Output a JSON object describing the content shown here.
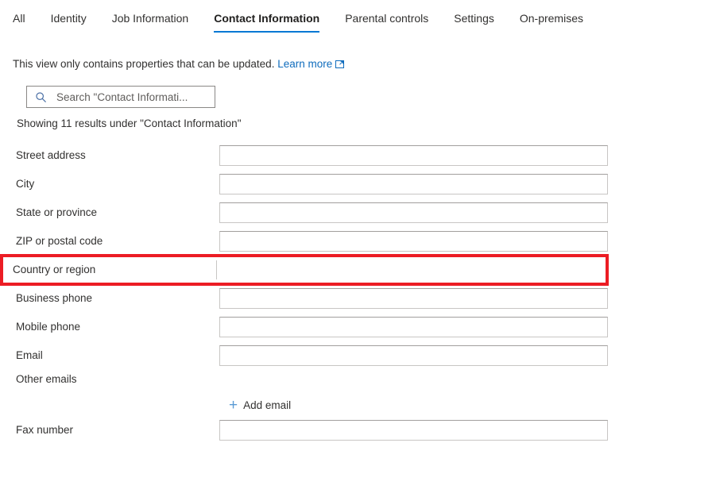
{
  "tabs": [
    {
      "label": "All",
      "active": false
    },
    {
      "label": "Identity",
      "active": false
    },
    {
      "label": "Job Information",
      "active": false
    },
    {
      "label": "Contact Information",
      "active": true
    },
    {
      "label": "Parental controls",
      "active": false
    },
    {
      "label": "Settings",
      "active": false
    },
    {
      "label": "On-premises",
      "active": false
    }
  ],
  "notice": {
    "text": "This view only contains properties that can be updated.",
    "link_label": "Learn more",
    "link_icon": "external-link-icon"
  },
  "search": {
    "icon": "search-icon",
    "placeholder": "Search \"Contact Informati...",
    "value": ""
  },
  "results": {
    "text": "Showing 11 results under \"Contact Information\"",
    "count": 11,
    "section": "Contact Information"
  },
  "fields": [
    {
      "label": "Street address",
      "value": "",
      "highlighted": false
    },
    {
      "label": "City",
      "value": "",
      "highlighted": false
    },
    {
      "label": "State or province",
      "value": "",
      "highlighted": false
    },
    {
      "label": "ZIP or postal code",
      "value": "",
      "highlighted": false
    },
    {
      "label": "Country or region",
      "value": "",
      "highlighted": true
    },
    {
      "label": "Business phone",
      "value": "",
      "highlighted": false
    },
    {
      "label": "Mobile phone",
      "value": "",
      "highlighted": false
    },
    {
      "label": "Email",
      "value": "",
      "highlighted": false
    }
  ],
  "other_emails": {
    "label": "Other emails",
    "add_label": "Add email",
    "add_icon": "plus-icon"
  },
  "fax": {
    "label": "Fax number",
    "value": ""
  },
  "colors": {
    "accent": "#0078d4",
    "link": "#0f6cbd",
    "highlight": "#ec1c24",
    "text": "#323130",
    "field_border": "#c8c6c4"
  }
}
